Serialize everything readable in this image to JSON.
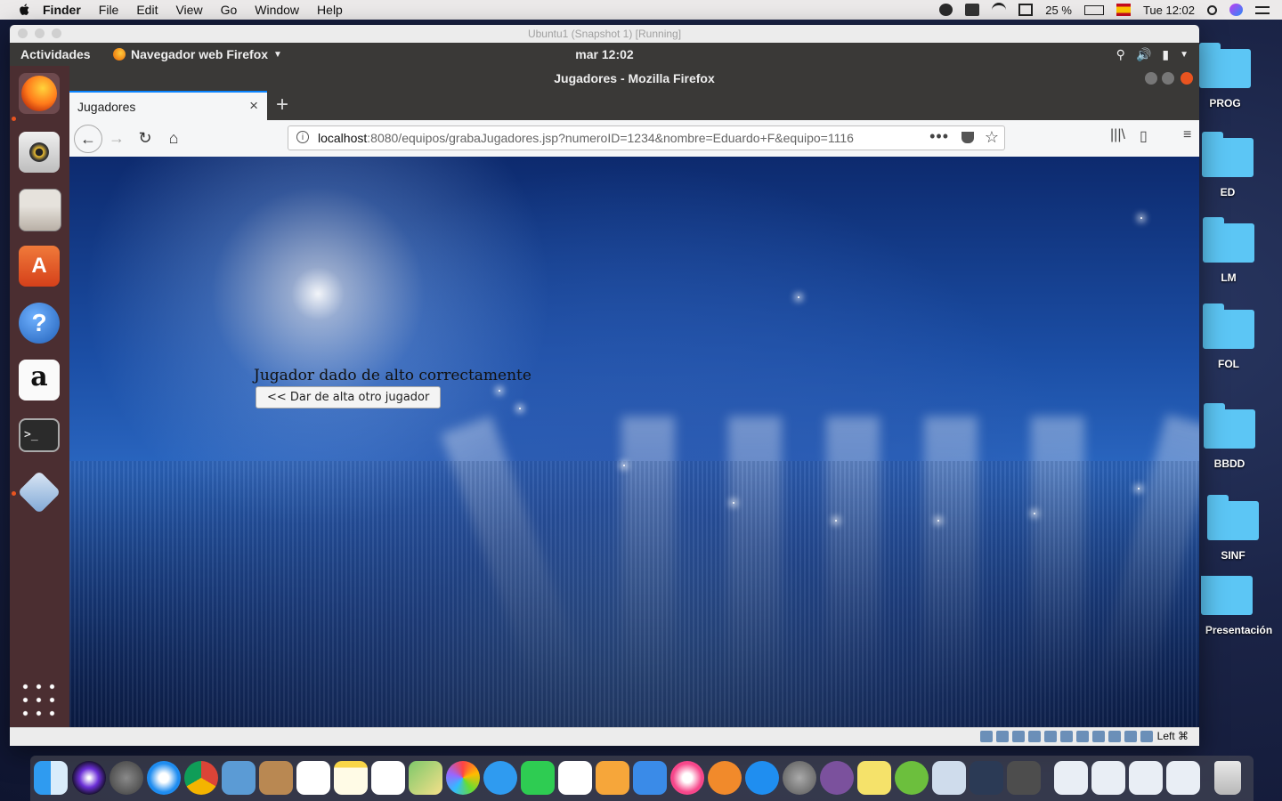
{
  "mac": {
    "app_name": "Finder",
    "menus": [
      "File",
      "Edit",
      "View",
      "Go",
      "Window",
      "Help"
    ],
    "battery": "25 %",
    "clock": "Tue 12:02"
  },
  "desktop_folders": [
    "PROG",
    "ED",
    "LM",
    "FOL",
    "BBDD",
    "SINF",
    "Presentación"
  ],
  "vbox": {
    "title": "Ubuntu1 (Snapshot 1) [Running]",
    "host_key": "Left ⌘"
  },
  "ubuntu": {
    "activities": "Actividades",
    "app_menu": "Navegador web Firefox",
    "clock": "mar 12:02",
    "dock_icons": [
      "firefox-icon",
      "rhythmbox-icon",
      "files-icon",
      "software-icon",
      "help-icon",
      "amazon-icon",
      "terminal-icon",
      "virtualbox-icon",
      "show-apps-icon"
    ]
  },
  "firefox": {
    "window_title": "Jugadores - Mozilla Firefox",
    "tab_label": "Jugadores",
    "url_host": "localhost",
    "url_path": ":8080/equipos/grabaJugadores.jsp?numeroID=1234&nombre=Eduardo+F&equipo=1116"
  },
  "page": {
    "message": "Jugador dado de alto correctamente",
    "back_button": "<< Dar de alta otro jugador"
  },
  "colors": {
    "ubuntu_orange": "#e95420",
    "ubuntu_panel": "#3a3937",
    "dock_bg": "#4b2e31",
    "folder_blue": "#5cc6f5",
    "ff_accent": "#0a84ff"
  }
}
